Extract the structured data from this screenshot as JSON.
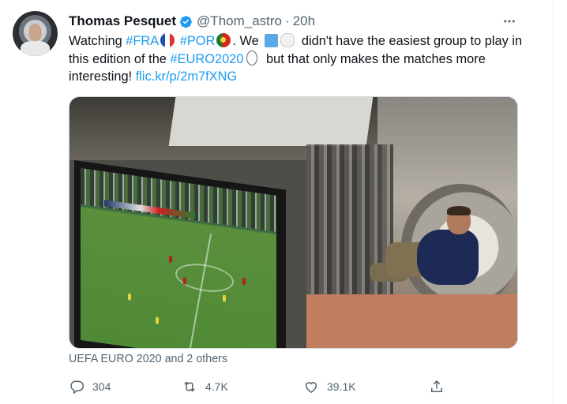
{
  "tweet": {
    "author_name": "Thomas Pesquet",
    "handle": "@Thom_astro",
    "separator": "·",
    "time": "20h",
    "text": {
      "p1": "Watching ",
      "hashtag1": "#FRA",
      "p2": " ",
      "hashtag2": "#POR",
      "p3": ". We ",
      "p4": " didn't have the easiest group to play in this edition of the ",
      "hashtag3": "#EURO2020",
      "p5": " but that only makes the matches more interesting! ",
      "link": "flic.kr/p/2m7fXNG"
    },
    "media_caption": "UEFA EURO 2020 and 2 others",
    "stats": {
      "replies": "304",
      "retweets": "4.7K",
      "likes": "39.1K"
    }
  },
  "icons": {
    "verified": "verified-badge-icon",
    "more": "more-options-icon",
    "reply": "reply-icon",
    "retweet": "retweet-icon",
    "like": "heart-icon",
    "share": "share-icon"
  },
  "colors": {
    "link": "#1d9bf0",
    "secondary_text": "#536471",
    "primary_text": "#0f1419"
  }
}
